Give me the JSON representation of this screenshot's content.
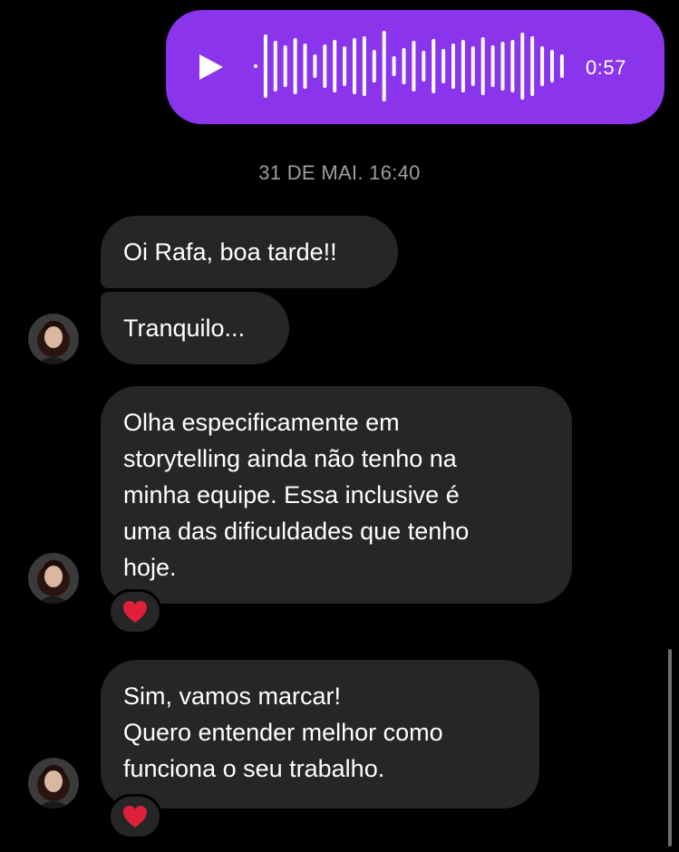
{
  "voice_message": {
    "duration": "0:57",
    "bubble_color": "#8a34ec",
    "icon": "play-icon"
  },
  "timestamp": "31 DE MAI. 16:40",
  "messages": [
    {
      "lines": [
        "Oi Rafa, boa tarde!!"
      ]
    },
    {
      "lines": [
        "Tranquilo..."
      ]
    },
    {
      "lines": [
        "Olha especificamente em",
        "storytelling ainda não tenho na",
        "minha equipe. Essa inclusive é",
        "uma das dificuldades que tenho",
        "hoje."
      ],
      "reaction": "heart-icon"
    },
    {
      "lines": [
        "Sim, vamos marcar!",
        "Quero entender melhor como",
        "funciona o seu trabalho."
      ],
      "reaction": "heart-icon"
    }
  ],
  "colors": {
    "background": "#000000",
    "incoming_bubble": "#262626",
    "timestamp_text": "#9e9e9e",
    "reaction_heart": "#e0203a"
  }
}
